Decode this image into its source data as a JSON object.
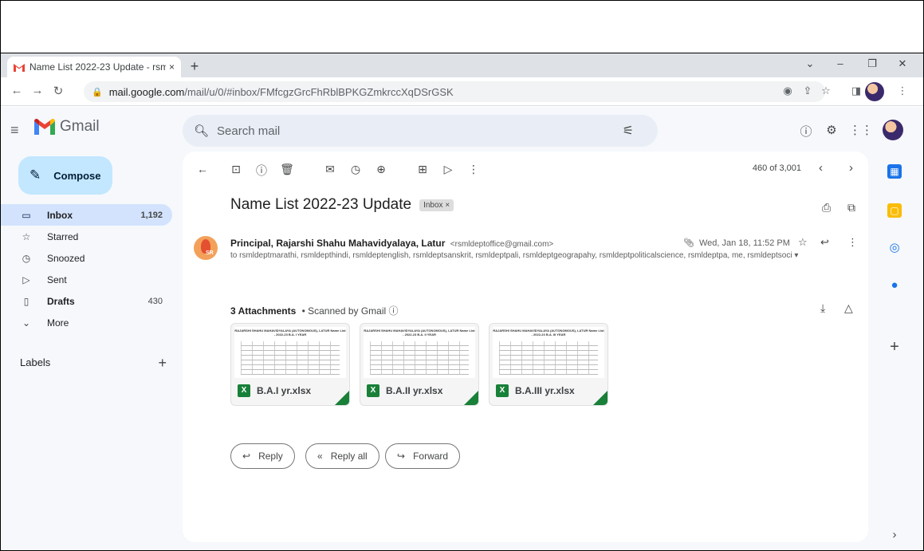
{
  "browser": {
    "tab_title": "Name List 2022-23 Update - rsm",
    "tab_close": "×",
    "new_tab": "+",
    "url_host": "mail.google.com",
    "url_path": "/mail/u/0/#inbox/FMfcgzGrcFhRblBPKGZmkrccXqDSrGSK"
  },
  "gmail": {
    "logo_text": "Gmail",
    "search_placeholder": "Search mail",
    "compose_label": "Compose",
    "nav": [
      {
        "label": "Inbox",
        "count": "1,192"
      },
      {
        "label": "Starred",
        "count": ""
      },
      {
        "label": "Snoozed",
        "count": ""
      },
      {
        "label": "Sent",
        "count": ""
      },
      {
        "label": "Drafts",
        "count": "430"
      },
      {
        "label": "More",
        "count": ""
      }
    ],
    "labels_title": "Labels",
    "labels_add": "+"
  },
  "message": {
    "pager": "460 of 3,001",
    "subject": "Name List 2022-23 Update",
    "badge": "Inbox ×",
    "sender_name": "Principal, Rajarshi Shahu Mahavidyalaya, Latur",
    "sender_email": "<rsmldeptoffice@gmail.com>",
    "date": "Wed, Jan 18, 11:52 PM",
    "recipients": "to rsmldeptmarathi, rsmldepthindi, rsmldeptenglish, rsmldeptsanskrit, rsmldeptpali, rsmldeptgeograpahy, rsmldeptpoliticalscience, rsmldeptpa, me, rsmldeptsoci ▾",
    "attachments_count": "3 Attachments",
    "attachments_scanned": "• Scanned by Gmail ⓘ",
    "attachments": [
      {
        "name": "B.A.I yr.xlsx",
        "thumb_title": "RAJARSHI SHAHU MAHAVIDYALAYA (AUTONOMOUS), LATUR Name List - 2022-23 B.A. I YEAR"
      },
      {
        "name": "B.A.II yr.xlsx",
        "thumb_title": "RAJARSHI SHAHU MAHAVIDYALAYA (AUTONOMOUS), LATUR Name List - 2022-23 B.A. II YEAR"
      },
      {
        "name": "B.A.III yr.xlsx",
        "thumb_title": "RAJARSHI SHAHU MAHAVIDYALAYA (AUTONOMOUS), LATUR Name List - 2022-23 B.A. III YEAR"
      }
    ],
    "reply": "Reply",
    "reply_all": "Reply all",
    "forward": "Forward",
    "sender_avatar_mark": "SR"
  },
  "colors": {
    "gmail_bg": "#f6f8fc",
    "compose": "#c2e7ff",
    "inbox_active": "#d3e3fd",
    "excel_green": "#188038"
  }
}
